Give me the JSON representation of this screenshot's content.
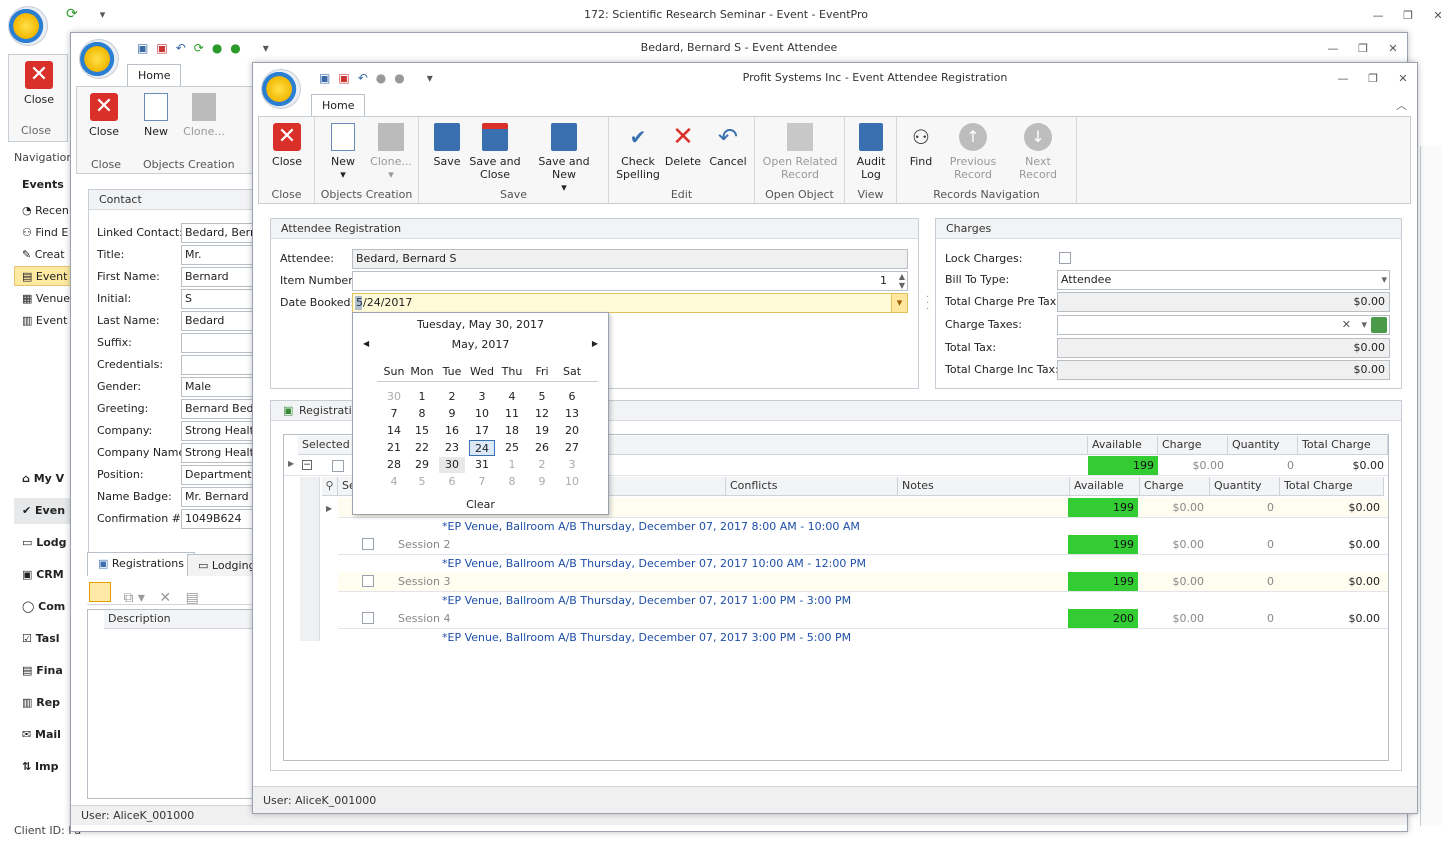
{
  "main_window": {
    "title": "172: Scientific Research Seminar - Event - EventPro",
    "close_label": "Close",
    "close_group": "Close",
    "navigation_label": "Navigation",
    "events_label": "Events",
    "nav_items": [
      "Recen",
      "Find E",
      "Creat",
      "Event",
      "Venue",
      "Event"
    ],
    "side_items": [
      "My V",
      "Even",
      "Lodg",
      "CRM",
      "Com",
      "Tasl",
      "Fina",
      "Rep",
      "Mail",
      "Imp"
    ],
    "client_id": "Client ID: Pa"
  },
  "attendee_window": {
    "title": "Bedard, Bernard S - Event Attendee",
    "home_tab": "Home",
    "close_label": "Close",
    "new_label": "New",
    "clone_label": "Clone...",
    "close_group": "Close",
    "objects_group": "Objects Creation",
    "contact_header": "Contact",
    "fields": [
      {
        "label": "Linked Contact:",
        "value": "Bedard, Berna"
      },
      {
        "label": "Title:",
        "value": "Mr."
      },
      {
        "label": "First Name:",
        "value": "Bernard"
      },
      {
        "label": "Initial:",
        "value": "S"
      },
      {
        "label": "Last Name:",
        "value": "Bedard"
      },
      {
        "label": "Suffix:",
        "value": ""
      },
      {
        "label": "Credentials:",
        "value": ""
      },
      {
        "label": "Gender:",
        "value": "Male"
      },
      {
        "label": "Greeting:",
        "value": "Bernard Bedar"
      },
      {
        "label": "Company:",
        "value": "Strong Health"
      },
      {
        "label": "Company Name:",
        "value": "Strong Health"
      },
      {
        "label": "Position:",
        "value": "Department C"
      },
      {
        "label": "Name Badge:",
        "value": "Mr. Bernard B"
      },
      {
        "label": "Confirmation #:",
        "value": "1049B624"
      }
    ],
    "tab_registrations": "Registrations",
    "tab_lodging": "Lodging",
    "grid_header_description": "Description",
    "user": "User: AliceK_001000"
  },
  "registration_window": {
    "title": "Profit Systems Inc - Event Attendee Registration",
    "home_tab": "Home",
    "ribbon": {
      "close": "Close",
      "new": "New",
      "clone": "Clone...",
      "save": "Save",
      "save_close": "Save and Close",
      "save_new": "Save and New",
      "check_spelling": "Check Spelling",
      "delete": "Delete",
      "cancel": "Cancel",
      "open_related": "Open Related Record",
      "audit_log": "Audit Log",
      "find": "Find",
      "previous_record": "Previous Record",
      "next_record": "Next Record",
      "groups": {
        "close": "Close",
        "objects": "Objects Creation",
        "save": "Save",
        "edit": "Edit",
        "open_object": "Open Object",
        "view": "View",
        "records_nav": "Records Navigation"
      }
    },
    "attendee_reg": {
      "header": "Attendee Registration",
      "attendee_label": "Attendee:",
      "attendee_value": "Bedard, Bernard S",
      "item_number_label": "Item Number:",
      "item_number_value": "1",
      "date_booked_label": "Date Booked:",
      "date_booked_value": "5/24/2017"
    },
    "charges": {
      "header": "Charges",
      "lock_label": "Lock Charges:",
      "bill_to_label": "Bill To Type:",
      "bill_to_value": "Attendee",
      "pre_tax_label": "Total Charge Pre Tax:",
      "pre_tax_value": "$0.00",
      "taxes_label": "Charge Taxes:",
      "total_tax_label": "Total Tax:",
      "total_tax_value": "$0.00",
      "inc_tax_label": "Total Charge Inc Tax:",
      "inc_tax_value": "$0.00"
    },
    "registrations_header": "Registratio",
    "grid": {
      "col_selected": "Selected",
      "col_available": "Available",
      "col_charge": "Charge",
      "col_quantity": "Quantity",
      "col_total_charge": "Total Charge",
      "parent_row": {
        "available": "199",
        "charge": "$0.00",
        "quantity": "0",
        "total": "$0.00"
      },
      "sub_cols": {
        "sel": "Se",
        "conflicts": "Conflicts",
        "notes": "Notes",
        "available": "Available",
        "charge": "Charge",
        "quantity": "Quantity",
        "total": "Total Charge"
      },
      "sessions": [
        {
          "name": "",
          "available": "199",
          "charge": "$0.00",
          "quantity": "0",
          "total": "$0.00",
          "venue": "*EP Venue, Ballroom A/B Thursday, December 07, 2017 8:00 AM - 10:00 AM"
        },
        {
          "name": "Session 2",
          "available": "199",
          "charge": "$0.00",
          "quantity": "0",
          "total": "$0.00",
          "venue": "*EP Venue, Ballroom A/B Thursday, December 07, 2017 10:00 AM - 12:00 PM"
        },
        {
          "name": "Session 3",
          "available": "199",
          "charge": "$0.00",
          "quantity": "0",
          "total": "$0.00",
          "venue": "*EP Venue, Ballroom A/B Thursday, December 07, 2017 1:00 PM - 3:00 PM"
        },
        {
          "name": "Session 4",
          "available": "200",
          "charge": "$0.00",
          "quantity": "0",
          "total": "$0.00",
          "venue": "*EP Venue, Ballroom A/B Thursday, December 07, 2017 3:00 PM - 5:00 PM"
        }
      ]
    },
    "calendar": {
      "today": "Tuesday, May 30, 2017",
      "month": "May, 2017",
      "weekdays": [
        "Sun",
        "Mon",
        "Tue",
        "Wed",
        "Thu",
        "Fri",
        "Sat"
      ],
      "weeks": [
        [
          "30",
          "1",
          "2",
          "3",
          "4",
          "5",
          "6"
        ],
        [
          "7",
          "8",
          "9",
          "10",
          "11",
          "12",
          "13"
        ],
        [
          "14",
          "15",
          "16",
          "17",
          "18",
          "19",
          "20"
        ],
        [
          "21",
          "22",
          "23",
          "24",
          "25",
          "26",
          "27"
        ],
        [
          "28",
          "29",
          "30",
          "31",
          "1",
          "2",
          "3"
        ],
        [
          "4",
          "5",
          "6",
          "7",
          "8",
          "9",
          "10"
        ]
      ],
      "clear": "Clear"
    },
    "user": "User: AliceK_001000"
  },
  "colors": {
    "available_green": "#33cc33",
    "venue_blue": "#1e4fa8",
    "date_yellow": "#fffbd9"
  }
}
